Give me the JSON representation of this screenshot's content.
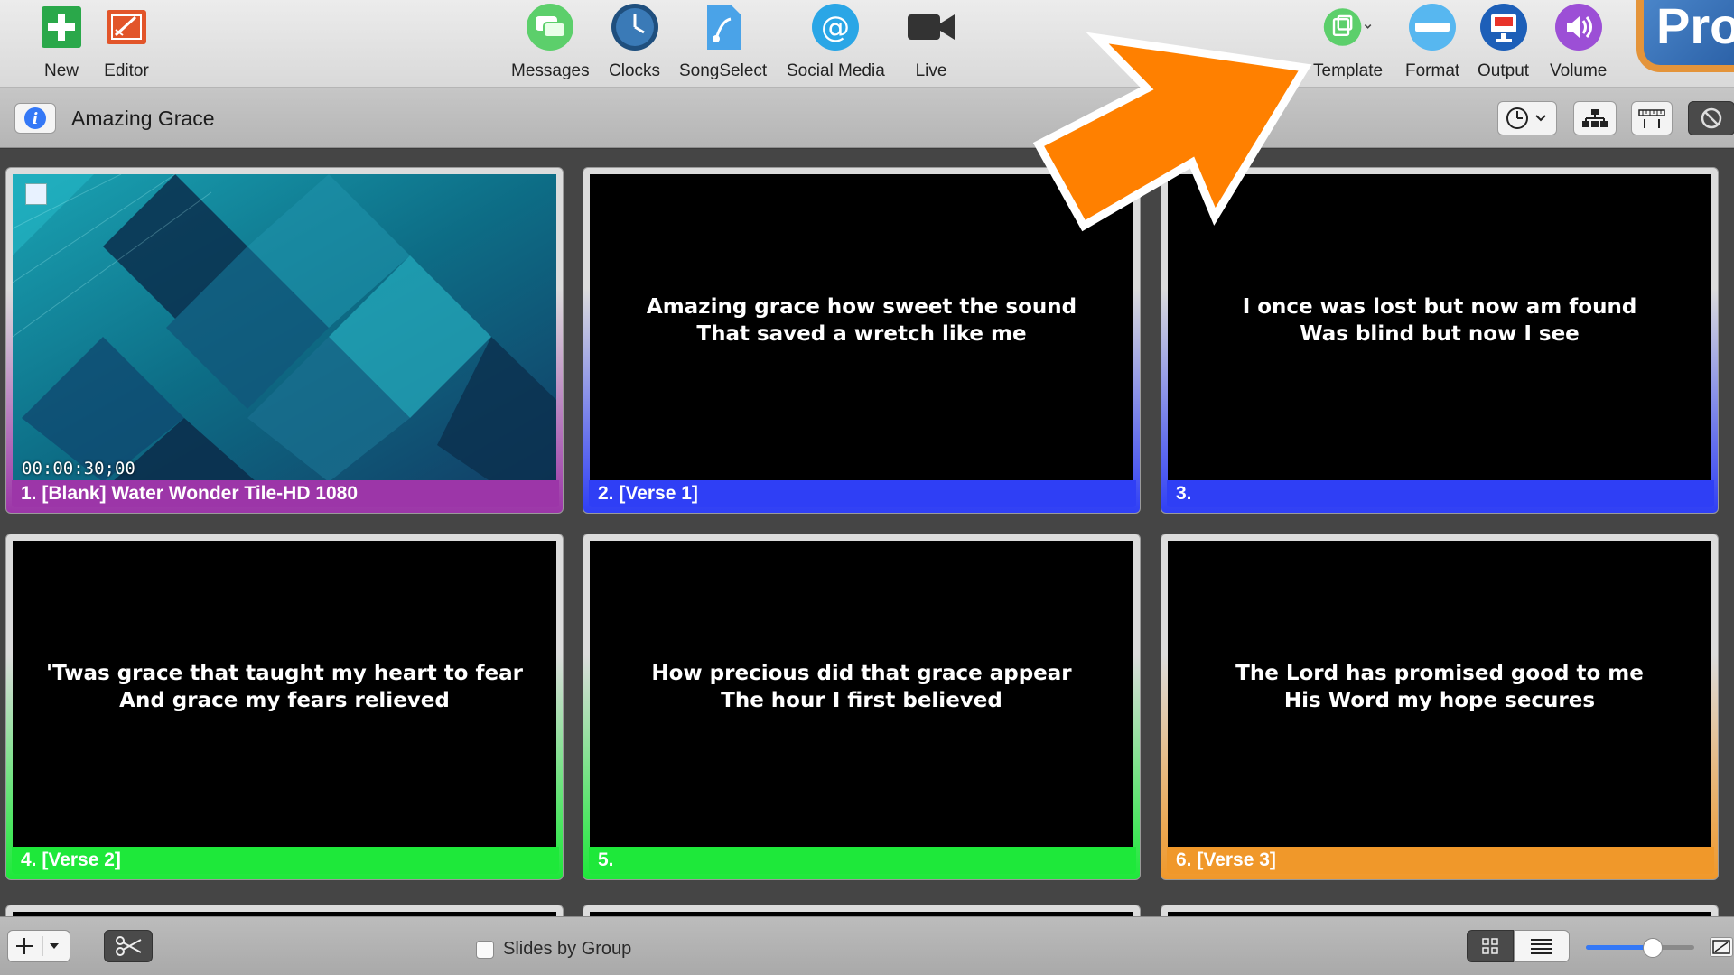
{
  "toolbar": {
    "new_label": "New",
    "editor_label": "Editor",
    "messages_label": "Messages",
    "clocks_label": "Clocks",
    "songselect_label": "SongSelect",
    "social_label": "Social Media",
    "live_label": "Live",
    "template_label": "Template",
    "format_label": "Format",
    "output_label": "Output",
    "volume_label": "Volume",
    "logo_text": "Pro"
  },
  "document": {
    "title": "Amazing Grace"
  },
  "slides": [
    {
      "label": "1. [Blank] Water Wonder Tile-HD 1080",
      "timecode": "00:00:30;00",
      "line1": "",
      "line2": "",
      "color": "#9c36a8"
    },
    {
      "label": "2. [Verse 1]",
      "line1": "Amazing grace how sweet the sound",
      "line2": "That saved a wretch like me",
      "color": "#2f3ff5"
    },
    {
      "label": "3.",
      "line1": "I once was lost but now am found",
      "line2": "Was blind but now I see",
      "color": "#2f3ff5"
    },
    {
      "label": "4. [Verse 2]",
      "line1": "'Twas grace that taught my heart to fear",
      "line2": "And grace my fears relieved",
      "color": "#1ee83a"
    },
    {
      "label": "5.",
      "line1": "How precious did that grace appear",
      "line2": "The hour I first believed",
      "color": "#1ee83a"
    },
    {
      "label": "6. [Verse 3]",
      "line1": "The Lord has promised good to me",
      "line2": "His Word my hope secures",
      "color": "#f0982a"
    }
  ],
  "bottombar": {
    "slides_by_group_label": "Slides by Group",
    "slides_by_group_checked": false,
    "zoom_level": 0.62
  },
  "colors": {
    "accent": "#3478f6",
    "annotation_arrow": "#ff8000"
  }
}
